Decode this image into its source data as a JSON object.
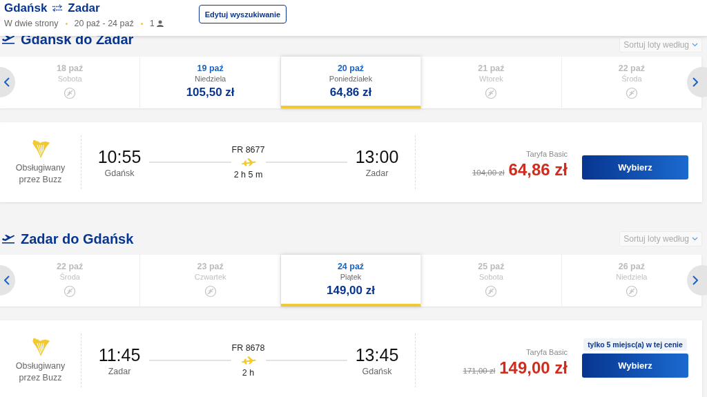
{
  "header": {
    "origin": "Gdańsk",
    "destination": "Zadar",
    "trip_type": "W dwie strony",
    "dates": "20 paź - 24 paź",
    "passengers": "1",
    "edit_button": "Edytuj wyszukiwanie"
  },
  "sections": [
    {
      "title": "Gdańsk do Zadar",
      "sort_label": "Sortuj loty według",
      "dates": [
        {
          "date": "18 paź",
          "day": "Sobota",
          "available": false,
          "selected": false
        },
        {
          "date": "19 paź",
          "day": "Niedziela",
          "price": "105,50 zł",
          "available": true,
          "selected": false
        },
        {
          "date": "20 paź",
          "day": "Poniedziałek",
          "price": "64,86 zł",
          "available": true,
          "selected": true
        },
        {
          "date": "21 paź",
          "day": "Wtorek",
          "available": false,
          "selected": false
        },
        {
          "date": "22 paź",
          "day": "Środa",
          "available": false,
          "selected": false
        }
      ],
      "flight": {
        "operator": "Obsługiwany przez Buzz",
        "departure_time": "10:55",
        "departure_city": "Gdańsk",
        "flight_number": "FR 8677",
        "duration": "2 h 5 m",
        "arrival_time": "13:00",
        "arrival_city": "Zadar",
        "fare": "Taryfa Basic",
        "old_price": "104,00 zł",
        "price": "64,86 zł",
        "button": "Wybierz"
      }
    },
    {
      "title": "Zadar do Gdańsk",
      "sort_label": "Sortuj loty według",
      "dates": [
        {
          "date": "22 paź",
          "day": "Środa",
          "available": false,
          "selected": false
        },
        {
          "date": "23 paź",
          "day": "Czwartek",
          "available": false,
          "selected": false
        },
        {
          "date": "24 paź",
          "day": "Piątek",
          "price": "149,00 zł",
          "available": true,
          "selected": true
        },
        {
          "date": "25 paź",
          "day": "Sobota",
          "available": false,
          "selected": false
        },
        {
          "date": "26 paź",
          "day": "Niedziela",
          "available": false,
          "selected": false
        }
      ],
      "flight": {
        "operator": "Obsługiwany przez Buzz",
        "departure_time": "11:45",
        "departure_city": "Zadar",
        "flight_number": "FR 8678",
        "duration": "2 h",
        "arrival_time": "13:45",
        "arrival_city": "Gdańsk",
        "fare": "Taryfa Basic",
        "old_price": "171,00 zł",
        "price": "149,00 zł",
        "badge": "tylko 5 miejsc(a) w tej cenie",
        "button": "Wybierz"
      }
    }
  ]
}
